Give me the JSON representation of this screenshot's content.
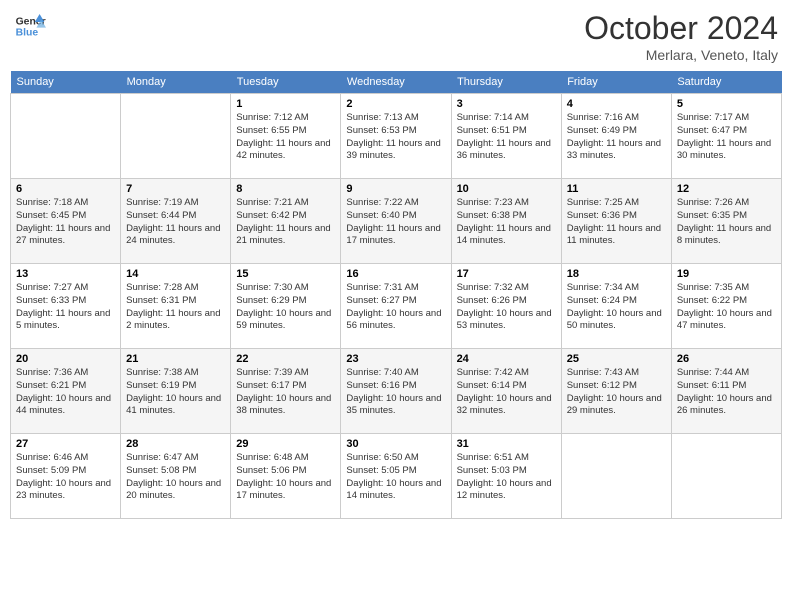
{
  "header": {
    "logo_line1": "General",
    "logo_line2": "Blue",
    "month": "October 2024",
    "location": "Merlara, Veneto, Italy"
  },
  "weekdays": [
    "Sunday",
    "Monday",
    "Tuesday",
    "Wednesday",
    "Thursday",
    "Friday",
    "Saturday"
  ],
  "weeks": [
    [
      {
        "day": "",
        "info": ""
      },
      {
        "day": "",
        "info": ""
      },
      {
        "day": "1",
        "info": "Sunrise: 7:12 AM\nSunset: 6:55 PM\nDaylight: 11 hours and 42 minutes."
      },
      {
        "day": "2",
        "info": "Sunrise: 7:13 AM\nSunset: 6:53 PM\nDaylight: 11 hours and 39 minutes."
      },
      {
        "day": "3",
        "info": "Sunrise: 7:14 AM\nSunset: 6:51 PM\nDaylight: 11 hours and 36 minutes."
      },
      {
        "day": "4",
        "info": "Sunrise: 7:16 AM\nSunset: 6:49 PM\nDaylight: 11 hours and 33 minutes."
      },
      {
        "day": "5",
        "info": "Sunrise: 7:17 AM\nSunset: 6:47 PM\nDaylight: 11 hours and 30 minutes."
      }
    ],
    [
      {
        "day": "6",
        "info": "Sunrise: 7:18 AM\nSunset: 6:45 PM\nDaylight: 11 hours and 27 minutes."
      },
      {
        "day": "7",
        "info": "Sunrise: 7:19 AM\nSunset: 6:44 PM\nDaylight: 11 hours and 24 minutes."
      },
      {
        "day": "8",
        "info": "Sunrise: 7:21 AM\nSunset: 6:42 PM\nDaylight: 11 hours and 21 minutes."
      },
      {
        "day": "9",
        "info": "Sunrise: 7:22 AM\nSunset: 6:40 PM\nDaylight: 11 hours and 17 minutes."
      },
      {
        "day": "10",
        "info": "Sunrise: 7:23 AM\nSunset: 6:38 PM\nDaylight: 11 hours and 14 minutes."
      },
      {
        "day": "11",
        "info": "Sunrise: 7:25 AM\nSunset: 6:36 PM\nDaylight: 11 hours and 11 minutes."
      },
      {
        "day": "12",
        "info": "Sunrise: 7:26 AM\nSunset: 6:35 PM\nDaylight: 11 hours and 8 minutes."
      }
    ],
    [
      {
        "day": "13",
        "info": "Sunrise: 7:27 AM\nSunset: 6:33 PM\nDaylight: 11 hours and 5 minutes."
      },
      {
        "day": "14",
        "info": "Sunrise: 7:28 AM\nSunset: 6:31 PM\nDaylight: 11 hours and 2 minutes."
      },
      {
        "day": "15",
        "info": "Sunrise: 7:30 AM\nSunset: 6:29 PM\nDaylight: 10 hours and 59 minutes."
      },
      {
        "day": "16",
        "info": "Sunrise: 7:31 AM\nSunset: 6:27 PM\nDaylight: 10 hours and 56 minutes."
      },
      {
        "day": "17",
        "info": "Sunrise: 7:32 AM\nSunset: 6:26 PM\nDaylight: 10 hours and 53 minutes."
      },
      {
        "day": "18",
        "info": "Sunrise: 7:34 AM\nSunset: 6:24 PM\nDaylight: 10 hours and 50 minutes."
      },
      {
        "day": "19",
        "info": "Sunrise: 7:35 AM\nSunset: 6:22 PM\nDaylight: 10 hours and 47 minutes."
      }
    ],
    [
      {
        "day": "20",
        "info": "Sunrise: 7:36 AM\nSunset: 6:21 PM\nDaylight: 10 hours and 44 minutes."
      },
      {
        "day": "21",
        "info": "Sunrise: 7:38 AM\nSunset: 6:19 PM\nDaylight: 10 hours and 41 minutes."
      },
      {
        "day": "22",
        "info": "Sunrise: 7:39 AM\nSunset: 6:17 PM\nDaylight: 10 hours and 38 minutes."
      },
      {
        "day": "23",
        "info": "Sunrise: 7:40 AM\nSunset: 6:16 PM\nDaylight: 10 hours and 35 minutes."
      },
      {
        "day": "24",
        "info": "Sunrise: 7:42 AM\nSunset: 6:14 PM\nDaylight: 10 hours and 32 minutes."
      },
      {
        "day": "25",
        "info": "Sunrise: 7:43 AM\nSunset: 6:12 PM\nDaylight: 10 hours and 29 minutes."
      },
      {
        "day": "26",
        "info": "Sunrise: 7:44 AM\nSunset: 6:11 PM\nDaylight: 10 hours and 26 minutes."
      }
    ],
    [
      {
        "day": "27",
        "info": "Sunrise: 6:46 AM\nSunset: 5:09 PM\nDaylight: 10 hours and 23 minutes."
      },
      {
        "day": "28",
        "info": "Sunrise: 6:47 AM\nSunset: 5:08 PM\nDaylight: 10 hours and 20 minutes."
      },
      {
        "day": "29",
        "info": "Sunrise: 6:48 AM\nSunset: 5:06 PM\nDaylight: 10 hours and 17 minutes."
      },
      {
        "day": "30",
        "info": "Sunrise: 6:50 AM\nSunset: 5:05 PM\nDaylight: 10 hours and 14 minutes."
      },
      {
        "day": "31",
        "info": "Sunrise: 6:51 AM\nSunset: 5:03 PM\nDaylight: 10 hours and 12 minutes."
      },
      {
        "day": "",
        "info": ""
      },
      {
        "day": "",
        "info": ""
      }
    ]
  ]
}
